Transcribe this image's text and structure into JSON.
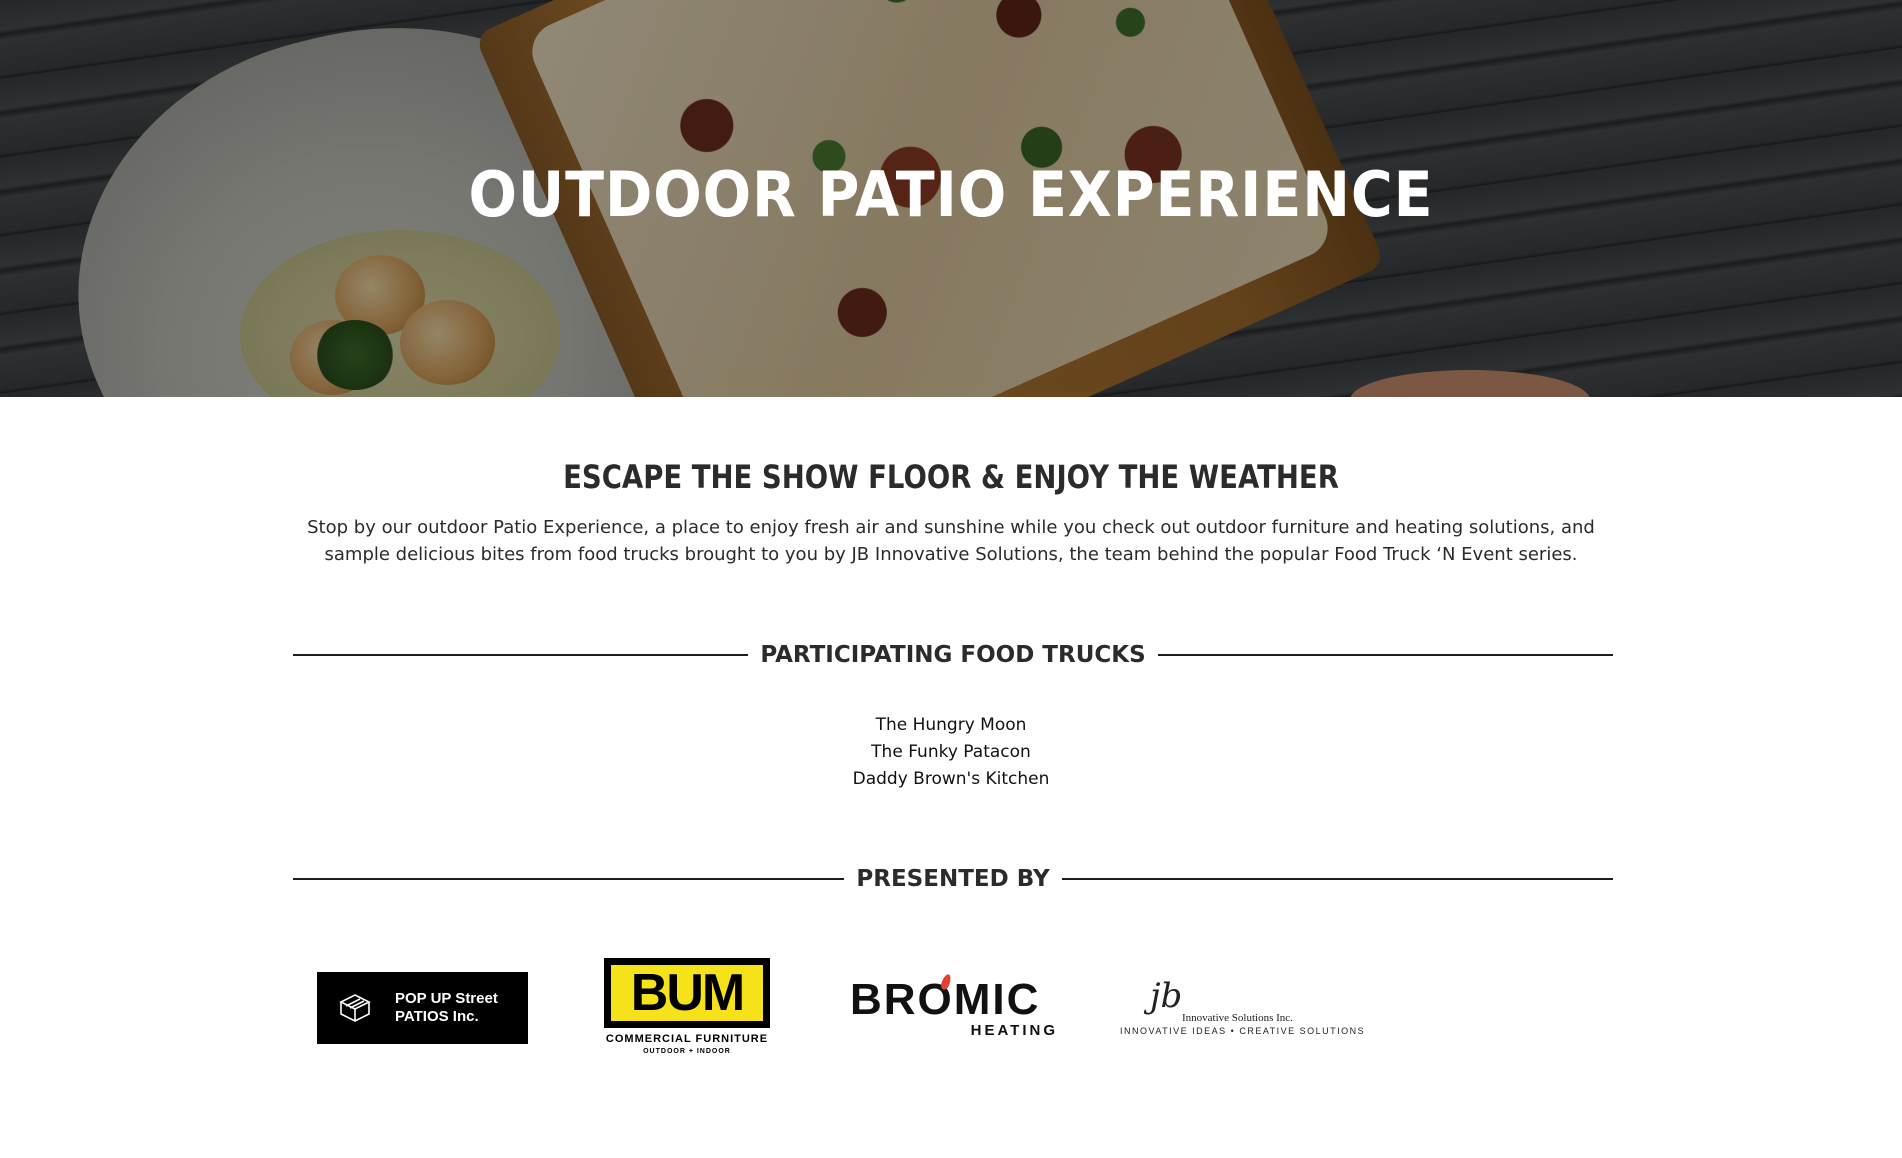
{
  "hero": {
    "title": "OUTDOOR PATIO EXPERIENCE"
  },
  "intro": {
    "heading": "ESCAPE THE SHOW FLOOR & ENJOY THE WEATHER",
    "body": "Stop by our outdoor Patio Experience, a place to enjoy fresh air and sunshine while you check out outdoor furniture and heating solutions, and sample delicious bites from food trucks brought to you by JB Innovative Solutions, the team behind the popular Food Truck ‘N Event series."
  },
  "food_trucks": {
    "heading": "PARTICIPATING FOOD TRUCKS",
    "items": [
      "The Hungry Moon",
      "The Funky Patacon",
      "Daddy Brown's Kitchen"
    ]
  },
  "presented_by": {
    "heading": "PRESENTED BY",
    "logos": {
      "popup": {
        "line1": "POP UP Street",
        "line2": "PATIOS Inc."
      },
      "bum": {
        "word": "BUM",
        "sub": "COMMERCIAL FURNITURE",
        "sub2": "OUTDOOR + INDOOR"
      },
      "bromic": {
        "word": "BROMIC",
        "sub": "HEATING"
      },
      "jb": {
        "script": "jb",
        "name": "Innovative Solutions Inc.",
        "tagline": "INNOVATIVE IDEAS • CREATIVE SOLUTIONS"
      }
    }
  },
  "colors": {
    "text": "#2b2b2b",
    "hero_text": "#ffffff",
    "bum_yellow": "#f5e21b",
    "bromic_flame": "#e2422b"
  }
}
